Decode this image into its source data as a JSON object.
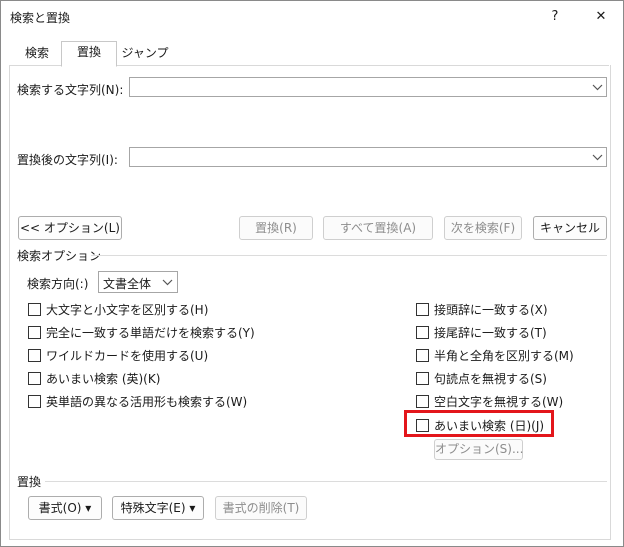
{
  "window": {
    "title": "検索と置換",
    "help_label": "?",
    "close_label": "✕"
  },
  "tabs": [
    {
      "label": "検索"
    },
    {
      "label": "置換"
    },
    {
      "label": "ジャンプ"
    }
  ],
  "find": {
    "label": "検索する文字列(N):",
    "value": ""
  },
  "replace": {
    "label": "置換後の文字列(I):",
    "value": ""
  },
  "buttons": {
    "options_toggle": "<< オプション(L)",
    "replace": "置換(R)",
    "replace_all": "すべて置換(A)",
    "find_next": "次を検索(F)",
    "cancel": "キャンセル"
  },
  "search_options": {
    "section_label": "検索オプション",
    "direction_label": "検索方向(:)",
    "direction_value": "文書全体",
    "left_checks": [
      "大文字と小文字を区別する(H)",
      "完全に一致する単語だけを検索する(Y)",
      "ワイルドカードを使用する(U)",
      "あいまい検索 (英)(K)",
      "英単語の異なる活用形も検索する(W)"
    ],
    "right_checks": [
      "接頭辞に一致する(X)",
      "接尾辞に一致する(T)",
      "半角と全角を区別する(M)",
      "句読点を無視する(S)",
      "空白文字を無視する(W)",
      "あいまい検索 (日)(J)"
    ],
    "options_button": "オプション(S)..."
  },
  "replace_section": {
    "label": "置換",
    "format_button": "書式(O) ▾",
    "special_button": "特殊文字(E) ▾",
    "clear_format_button": "書式の削除(T)"
  },
  "colors": {
    "highlight": "#e3161b"
  }
}
